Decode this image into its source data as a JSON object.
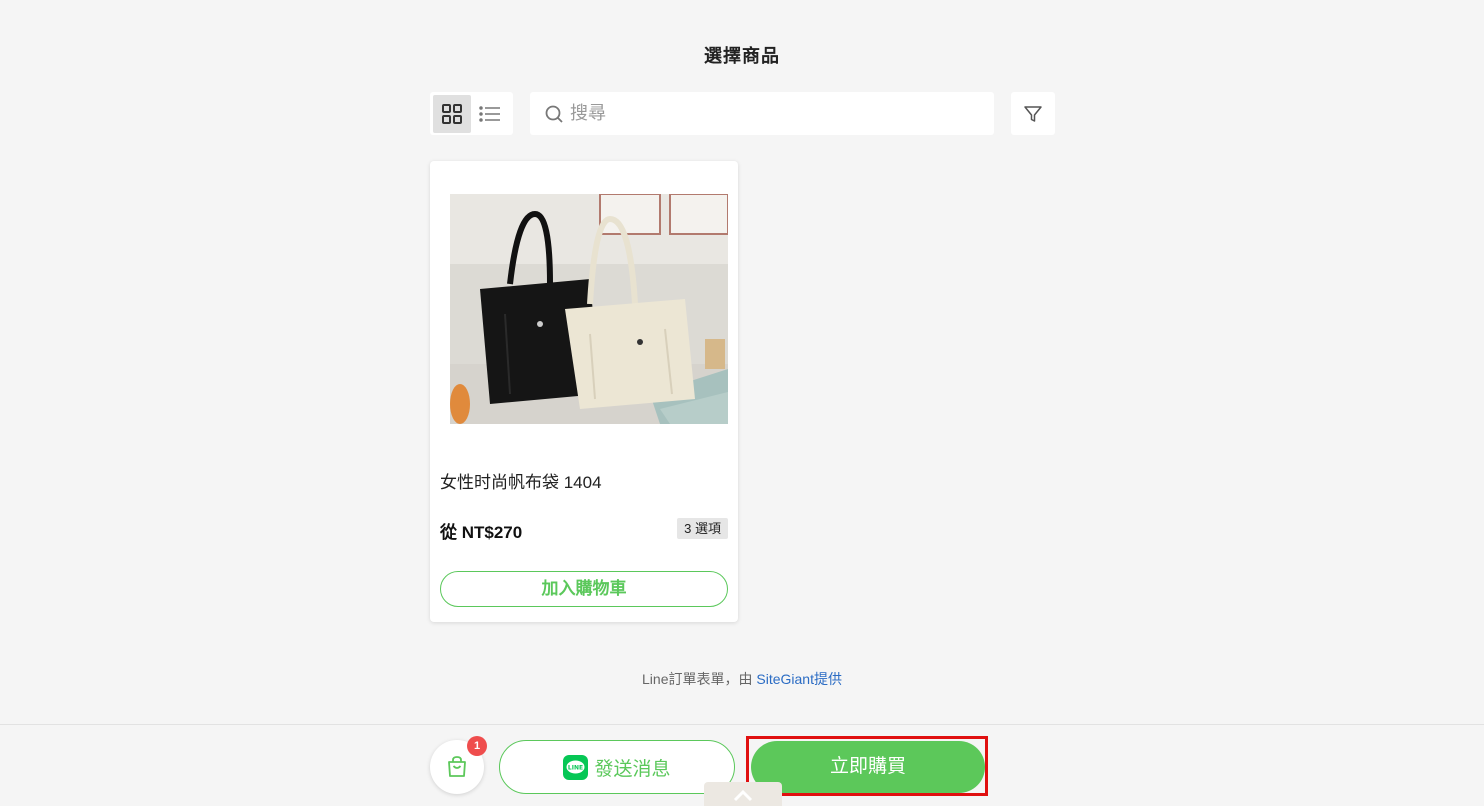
{
  "header": {
    "title": "選擇商品"
  },
  "view_toggle": {
    "active": "grid",
    "grid_icon": "grid-icon",
    "list_icon": "list-icon"
  },
  "search": {
    "placeholder": "搜尋",
    "value": "",
    "icon": "search-icon"
  },
  "filter": {
    "icon": "filter-icon"
  },
  "products": [
    {
      "name": "女性时尚帆布袋 1404",
      "price": "從 NT$270",
      "options": "3 選項",
      "add_to_cart_label": "加入購物車"
    }
  ],
  "footer": {
    "prefix": "Line訂單表單，由 ",
    "link": "SiteGiant提供"
  },
  "bottom_bar": {
    "cart_count": "1",
    "send_message_label": "發送消息",
    "buy_now_label": "立即購買"
  },
  "colors": {
    "accent_green": "#5cc85a",
    "line_green": "#06c755",
    "badge_red": "#ef4d4d",
    "highlight_red": "#e01010",
    "link_blue": "#2b6cc4"
  }
}
